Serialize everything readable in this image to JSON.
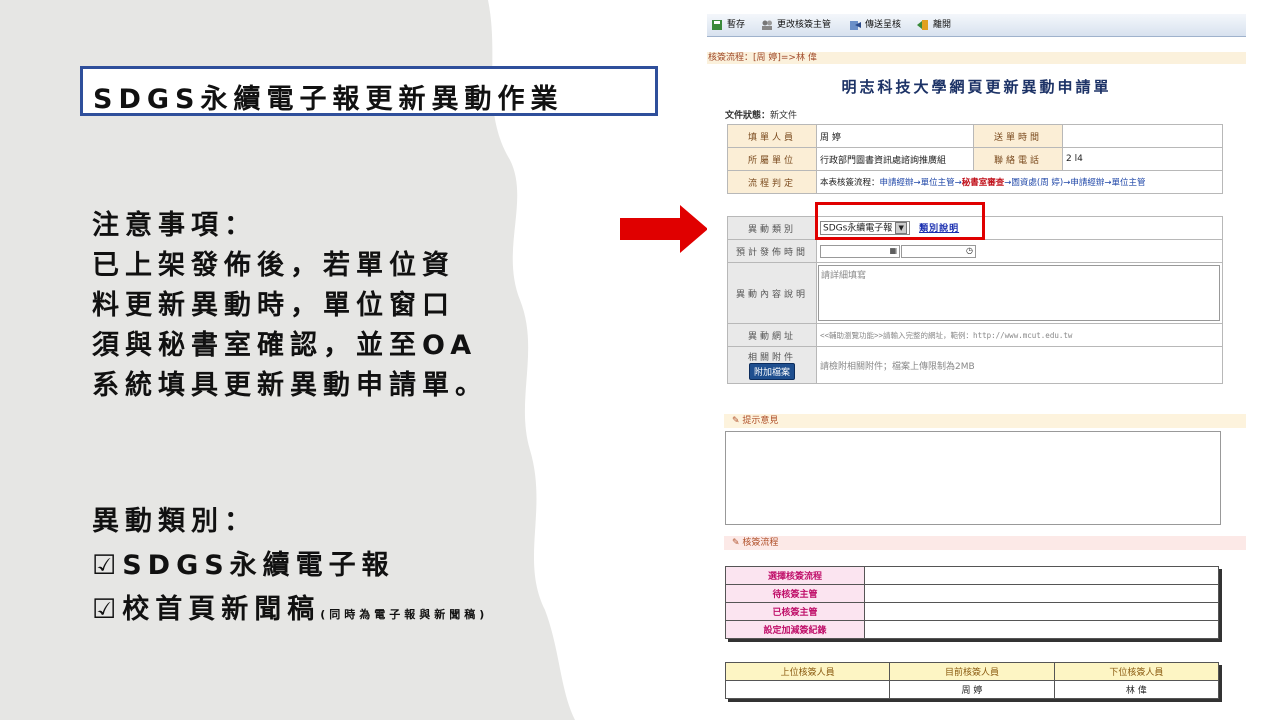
{
  "slide": {
    "title": "SDGS永續電子報更新異動作業",
    "notes": [
      "注意事項：",
      "已上架發佈後，若單位資",
      "料更新異動時，單位窗口",
      "須與秘書室確認，並至OA",
      "系統填具更新異動申請單。"
    ],
    "types_heading": "異動類別：",
    "type1": "☑SDGS永續電子報",
    "type2": "☑校首頁新聞稿",
    "type2_note": "(同時為電子報與新聞稿)",
    "colors": {
      "title_border": "#2f4f9b",
      "arrow": "#e00000",
      "background_shape": "#e6e6e4"
    }
  },
  "panel": {
    "toolbar": {
      "save": "暫存",
      "change_approver": "更改核簽主管",
      "send": "傳送呈核",
      "leave": "離開"
    },
    "flow_text": "核簽流程：[周 婷]=>林 偉",
    "form_title": "明志科技大學網頁更新異動申請單",
    "doc_status_label": "文件狀態：",
    "doc_status": "新文件",
    "info": {
      "applicant_label": "填單人員",
      "applicant": "周 婷",
      "send_time_label": "送單時間",
      "send_time": "",
      "dept_label": "所屬單位",
      "dept": "行政部門圖書資訊處諮詢推廣組",
      "phone_label": "聯絡電話",
      "phone": "2 l4",
      "flow_label": "流程判定",
      "flow_prefix": "本表核簽流程：",
      "flow_part1": "申請經辦→單位主管→",
      "flow_part2": "秘書室審查",
      "flow_part3": "→圖資處(周 婷)→申請經辦→單位主管"
    },
    "change": {
      "type_label": "異動類別",
      "type_value": "SDGs永續電子報",
      "type_link": "類別說明",
      "publish_label": "預計發佈時間",
      "content_label": "異動內容說明",
      "content_placeholder": "請詳細填寫",
      "url_label": "異動網址",
      "url_placeholder": "<<輔助瀏覽功能>>請輸入完整的網址，範例：http://www.mcut.edu.tw",
      "attach_label": "相關附件",
      "attach_button": "附加檔案",
      "attach_hint": "請檢附相關附件；檔案上傳限制為2MB"
    },
    "opinion_section": "提示意見",
    "approval_section": "核簽流程",
    "approval_rows": [
      "選擇核簽流程",
      "待核簽主管",
      "已核簽主管",
      "設定加減簽紀錄"
    ],
    "people": {
      "headers": [
        "上位核簽人員",
        "目前核簽人員",
        "下位核簽人員"
      ],
      "values": [
        "",
        "周 婷",
        "林 偉"
      ]
    }
  }
}
